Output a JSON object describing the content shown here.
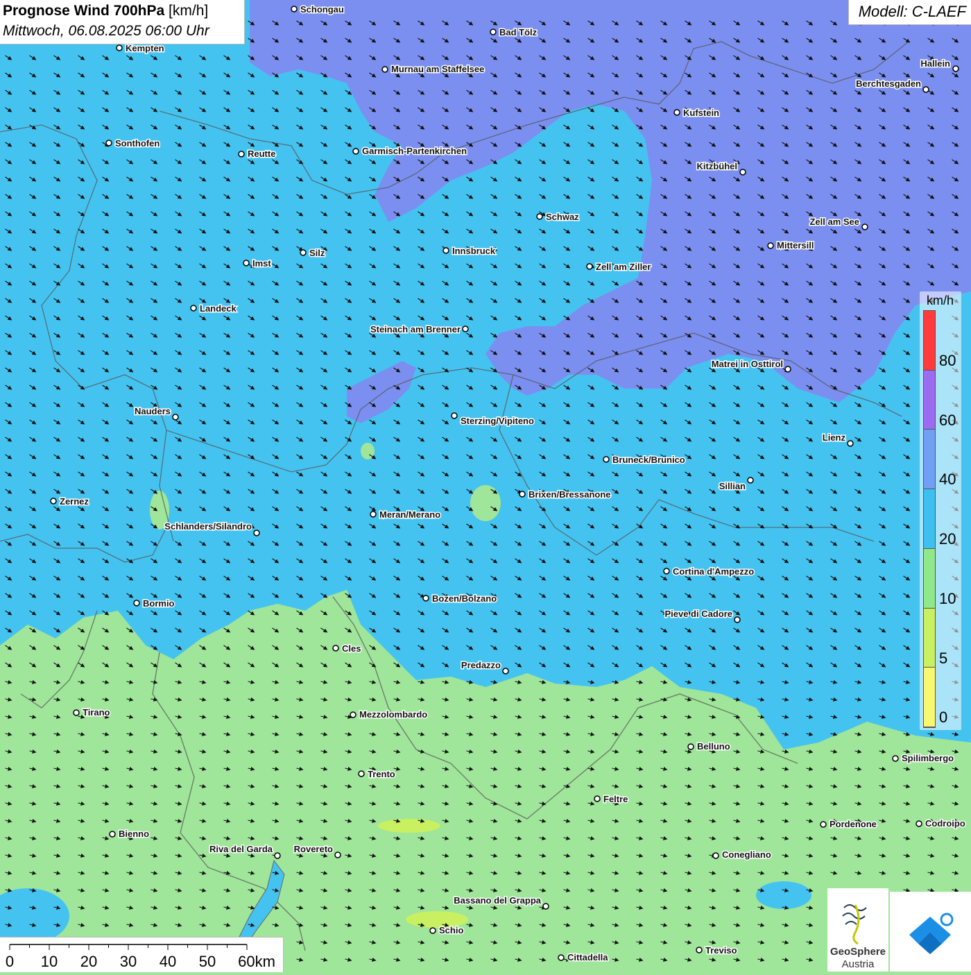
{
  "header": {
    "title_bold": "Prognose Wind 700hPa",
    "title_unit": "[km/h]",
    "datetime": "Mittwoch, 06.08.2025 06:00 Uhr"
  },
  "model": {
    "label": "Modell: C-LAEF"
  },
  "legend": {
    "unit": "km/h",
    "labels": [
      "80",
      "60",
      "40",
      "20",
      "10",
      "5",
      "0"
    ],
    "bands": [
      {
        "color": "#ff3b3b"
      },
      {
        "color": "#9b6cf2"
      },
      {
        "color": "#6fa0f5"
      },
      {
        "color": "#3dc0f0"
      },
      {
        "color": "#8fe88a"
      },
      {
        "color": "#c8f060"
      },
      {
        "color": "#f8f870"
      }
    ]
  },
  "scale_bar": {
    "labels": [
      "0",
      "10",
      "20",
      "30",
      "40",
      "50",
      "60km"
    ]
  },
  "logo": {
    "name": "GeoSphere",
    "sub": "Austria",
    "icon": "geosphere-logo-icon",
    "app_icon": "app-logo-icon"
  },
  "cities": [
    {
      "name": "Schongau"
    },
    {
      "name": "Bad Tölz"
    },
    {
      "name": "Kempten"
    },
    {
      "name": "Murnau am Staffelsee"
    },
    {
      "name": "Hallein"
    },
    {
      "name": "Berchtesgaden"
    },
    {
      "name": "Kufstein"
    },
    {
      "name": "Sonthofen"
    },
    {
      "name": "Reutte"
    },
    {
      "name": "Garmisch-Partenkirchen"
    },
    {
      "name": "Kitzbühel"
    },
    {
      "name": "Schwaz"
    },
    {
      "name": "Zell am See"
    },
    {
      "name": "Mittersill"
    },
    {
      "name": "Innsbruck"
    },
    {
      "name": "Silz"
    },
    {
      "name": "Imst"
    },
    {
      "name": "Zell am Ziller"
    },
    {
      "name": "Landeck"
    },
    {
      "name": "Steinach am Brenner"
    },
    {
      "name": "Matrei in Osttirol"
    },
    {
      "name": "Nauders"
    },
    {
      "name": "Sterzing/Vipiteno"
    },
    {
      "name": "Lienz"
    },
    {
      "name": "Bruneck/Brunico"
    },
    {
      "name": "Sillian"
    },
    {
      "name": "Brixen/Bressanone"
    },
    {
      "name": "Zernez"
    },
    {
      "name": "Meran/Merano"
    },
    {
      "name": "Schlanders/Silandro"
    },
    {
      "name": "Cortina d'Ampezzo"
    },
    {
      "name": "Bozen/Bolzano"
    },
    {
      "name": "Bormio"
    },
    {
      "name": "Pieve di Cadore"
    },
    {
      "name": "Cles"
    },
    {
      "name": "Predazzo"
    },
    {
      "name": "Tirano"
    },
    {
      "name": "Mezzolombardo"
    },
    {
      "name": "Belluno"
    },
    {
      "name": "Spilimbergo"
    },
    {
      "name": "Trento"
    },
    {
      "name": "Feltre"
    },
    {
      "name": "Pordenone"
    },
    {
      "name": "Codroipo"
    },
    {
      "name": "Bienno"
    },
    {
      "name": "Riva del Garda"
    },
    {
      "name": "Rovereto"
    },
    {
      "name": "Conegliano"
    },
    {
      "name": "Bassano del Grappa"
    },
    {
      "name": "Schio"
    },
    {
      "name": "Treviso"
    },
    {
      "name": "Cittadella"
    }
  ]
}
